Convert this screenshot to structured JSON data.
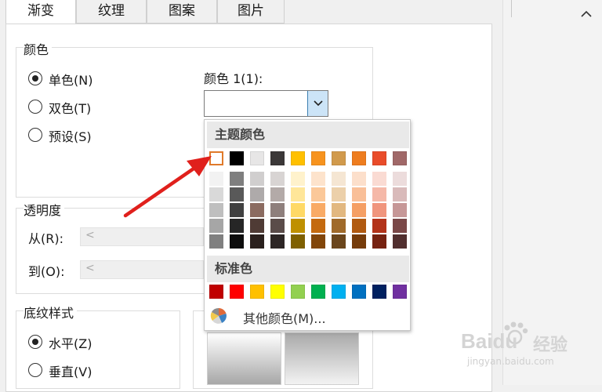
{
  "tabs": [
    "渐变",
    "纹理",
    "图案",
    "图片"
  ],
  "colors_group": {
    "title": "颜色",
    "options": [
      "单色(N)",
      "双色(T)",
      "预设(S)"
    ],
    "selected": 0,
    "color1_label": "颜色 1(1):"
  },
  "transparency_group": {
    "title": "透明度",
    "from_label": "从(R):",
    "to_label": "到(O):"
  },
  "shading_group": {
    "title": "底纹样式",
    "options": [
      "水平(Z)",
      "垂直(V)"
    ],
    "selected": 0
  },
  "palette": {
    "theme_title": "主题颜色",
    "theme_colors": [
      "#ffffff",
      "#000000",
      "#e7e6e6",
      "#3b3838",
      "#ffc000",
      "#f7931e",
      "#d19a4c",
      "#ee7d1f",
      "#e94c2a",
      "#a06868"
    ],
    "theme_shades": [
      [
        "#f2f2f2",
        "#d9d9d9",
        "#bfbfbf",
        "#a6a6a6",
        "#808080"
      ],
      [
        "#7f7f7f",
        "#595959",
        "#404040",
        "#262626",
        "#0d0d0d"
      ],
      [
        "#d0cece",
        "#aeaaaa",
        "#8b6b60",
        "#4f3b35",
        "#2a201d"
      ],
      [
        "#d8d4d3",
        "#b3aaa8",
        "#8e7f7c",
        "#5a4c49",
        "#2d2625"
      ],
      [
        "#fff2cc",
        "#ffe699",
        "#ffd966",
        "#bf9000",
        "#7f6000"
      ],
      [
        "#fde3cc",
        "#fbc899",
        "#f9ab66",
        "#c46a0f",
        "#82460a"
      ],
      [
        "#f5e6d3",
        "#ecd0aa",
        "#e2b880",
        "#a06a2a",
        "#6b461c"
      ],
      [
        "#fcdfcb",
        "#f9bf98",
        "#f59f64",
        "#b15a10",
        "#763c0a"
      ],
      [
        "#fadbd3",
        "#f5b8a8",
        "#f0957d",
        "#b3331a",
        "#762211"
      ],
      [
        "#ecdcdc",
        "#d9baba",
        "#c69797",
        "#7a4848",
        "#512f2f"
      ]
    ],
    "standard_title": "标准色",
    "standard_colors": [
      "#c00000",
      "#ff0000",
      "#ffc000",
      "#ffff00",
      "#92d050",
      "#00b050",
      "#00b0f0",
      "#0070c0",
      "#002060",
      "#7030a0"
    ],
    "more_colors": "其他颜色(M)..."
  },
  "watermark": {
    "brand": "Baidu",
    "suffix": "经验",
    "url": "jingyan.baidu.com"
  },
  "accent": "#e0201c"
}
